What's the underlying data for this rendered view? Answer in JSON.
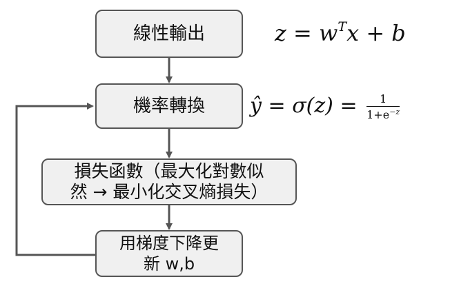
{
  "nodes": {
    "linear_output": "線性輸出",
    "probability_transform": "機率轉換",
    "loss_line1": "損失函數（最大化對數似",
    "loss_line2": "然 → 最小化交叉熵損失）",
    "gradient_line1": "用梯度下降更",
    "gradient_line2": "新 w,b"
  },
  "equations": {
    "linear": {
      "lhs": "z",
      "eq": "=",
      "w": "w",
      "sup_T": "T",
      "x": "x",
      "plus": "+",
      "b": "b"
    },
    "sigmoid": {
      "lhs": "ŷ",
      "eq1": "=",
      "sigma": "σ(z)",
      "eq2": "=",
      "numerator": "1",
      "denominator_base": "1+e",
      "denominator_exp": "−z"
    }
  },
  "colors": {
    "box_fill": "#f0f0f0",
    "box_border": "#555555",
    "arrow": "#555555",
    "text": "#111111"
  }
}
